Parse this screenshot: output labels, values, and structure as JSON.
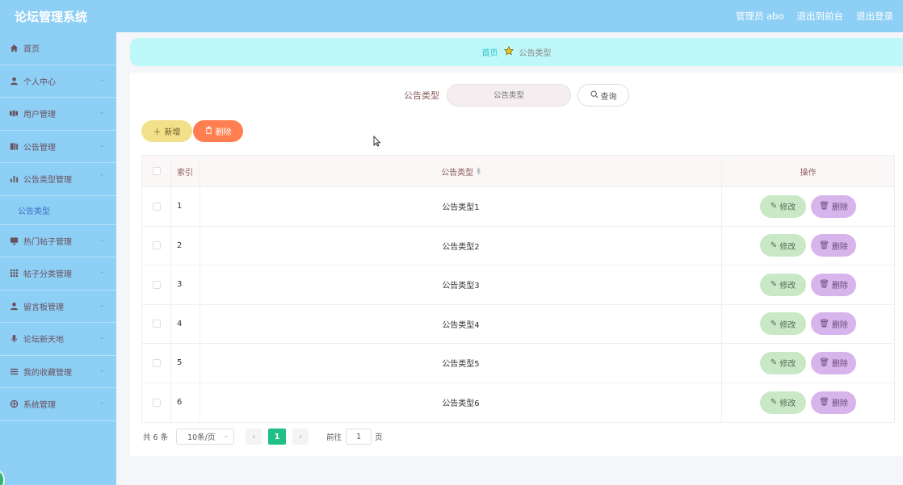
{
  "topbar": {
    "title": "论坛管理系统",
    "user_label": "管理员 abo",
    "to_frontend": "退出到前台",
    "logout": "退出登录"
  },
  "sidebar": {
    "items": [
      {
        "label": "首页",
        "icon": "home-icon",
        "has_children": false
      },
      {
        "label": "个人中心",
        "icon": "user-icon",
        "has_children": true
      },
      {
        "label": "用户管理",
        "icon": "users-icon",
        "has_children": true
      },
      {
        "label": "公告管理",
        "icon": "book-icon",
        "has_children": true
      },
      {
        "label": "公告类型管理",
        "icon": "bar-chart-icon",
        "has_children": true,
        "expanded": true,
        "children": [
          {
            "label": "公告类型"
          }
        ]
      },
      {
        "label": "热门帖子管理",
        "icon": "monitor-icon",
        "has_children": true
      },
      {
        "label": "帖子分类管理",
        "icon": "grid-icon",
        "has_children": true
      },
      {
        "label": "留言板管理",
        "icon": "person-icon",
        "has_children": true
      },
      {
        "label": "论坛新天地",
        "icon": "mic-icon",
        "has_children": true
      },
      {
        "label": "我的收藏管理",
        "icon": "list-icon",
        "has_children": true
      },
      {
        "label": "系统管理",
        "icon": "settings-icon",
        "has_children": true
      }
    ]
  },
  "breadcrumb": {
    "home": "首页",
    "current": "公告类型"
  },
  "search": {
    "label": "公告类型",
    "placeholder": "公告类型",
    "button": "查询"
  },
  "actions": {
    "add": "新增",
    "delete": "删除"
  },
  "table": {
    "headers": {
      "index": "索引",
      "type": "公告类型",
      "ops": "操作"
    },
    "rows": [
      {
        "index": "1",
        "type": "公告类型1"
      },
      {
        "index": "2",
        "type": "公告类型2"
      },
      {
        "index": "3",
        "type": "公告类型3"
      },
      {
        "index": "4",
        "type": "公告类型4"
      },
      {
        "index": "5",
        "type": "公告类型5"
      },
      {
        "index": "6",
        "type": "公告类型6"
      }
    ],
    "edit_label": "修改",
    "delete_label": "删除"
  },
  "pagination": {
    "total": "共 6 条",
    "page_size": "10条/页",
    "current_page": "1",
    "goto_label": "前往",
    "goto_value": "1",
    "page_suffix": "页"
  },
  "colors": {
    "topbar": "#8ecff5",
    "breadcrumb_bg": "#bff8f8",
    "add_button": "#f2e18a",
    "delete_button": "#ff7f50",
    "edit_op": "#c9e9c6",
    "delete_op": "#d8b4ec",
    "pager_active": "#1fbf86"
  }
}
